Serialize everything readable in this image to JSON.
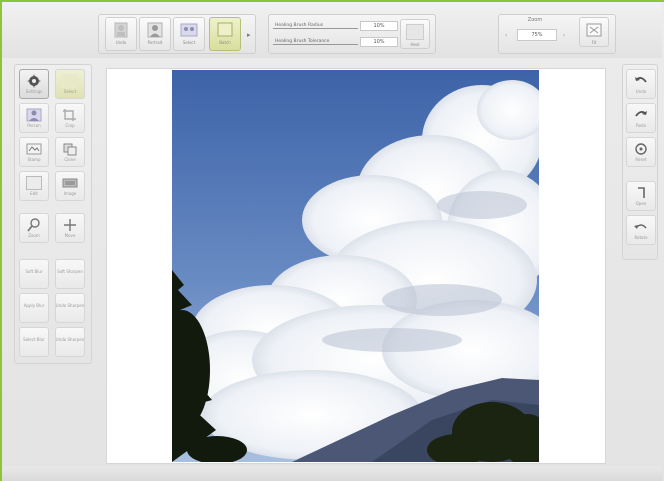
{
  "toolbar": {
    "tools": [
      {
        "label": "Undo"
      },
      {
        "label": "Portrait"
      },
      {
        "label": "Select"
      },
      {
        "label": "Batch"
      }
    ],
    "sliders": [
      {
        "label": "Healing Brush Radius",
        "value": "10%"
      },
      {
        "label": "Healing Brush Tolerance",
        "value": "10%"
      }
    ],
    "heal_button": "Heal",
    "zoom": {
      "label": "Zoom",
      "value": "75%"
    },
    "fit_button": "Fit"
  },
  "left_tools": [
    {
      "label": "Settings",
      "icon": "gear-icon"
    },
    {
      "label": "Select",
      "icon": "select-icon"
    },
    {
      "label": "Person",
      "icon": "person-icon"
    },
    {
      "label": "Crop",
      "icon": "crop-icon"
    },
    {
      "label": "Stamp",
      "icon": "stamp-icon"
    },
    {
      "label": "Clone",
      "icon": "clone-icon"
    },
    {
      "label": "Edit",
      "icon": "edit-icon"
    },
    {
      "label": "Image",
      "icon": "image-icon"
    },
    {
      "label": "Zoom",
      "icon": "zoom-icon"
    },
    {
      "label": "Move",
      "icon": "move-icon"
    },
    {
      "label": "Soft Blur",
      "icon": "text-icon"
    },
    {
      "label": "Soft Sharpen",
      "icon": "text-icon"
    },
    {
      "label": "Apply Blur",
      "icon": "text-icon"
    },
    {
      "label": "Undo Sharpen",
      "icon": "text-icon"
    },
    {
      "label": "Select Blur",
      "icon": "text-icon"
    },
    {
      "label": "Undo Sharpen",
      "icon": "text-icon"
    }
  ],
  "right_tools": [
    {
      "label": "Undo",
      "icon": "undo-icon"
    },
    {
      "label": "Redo",
      "icon": "redo-icon"
    },
    {
      "label": "Reset",
      "icon": "reset-icon"
    },
    {
      "label": "Open",
      "icon": "open-icon"
    },
    {
      "label": "Rotate",
      "icon": "rotate-icon"
    }
  ],
  "colors": {
    "accent_border": "#8cc43a",
    "active_tool": "#d8de9a",
    "sky": "#4f72b0"
  }
}
